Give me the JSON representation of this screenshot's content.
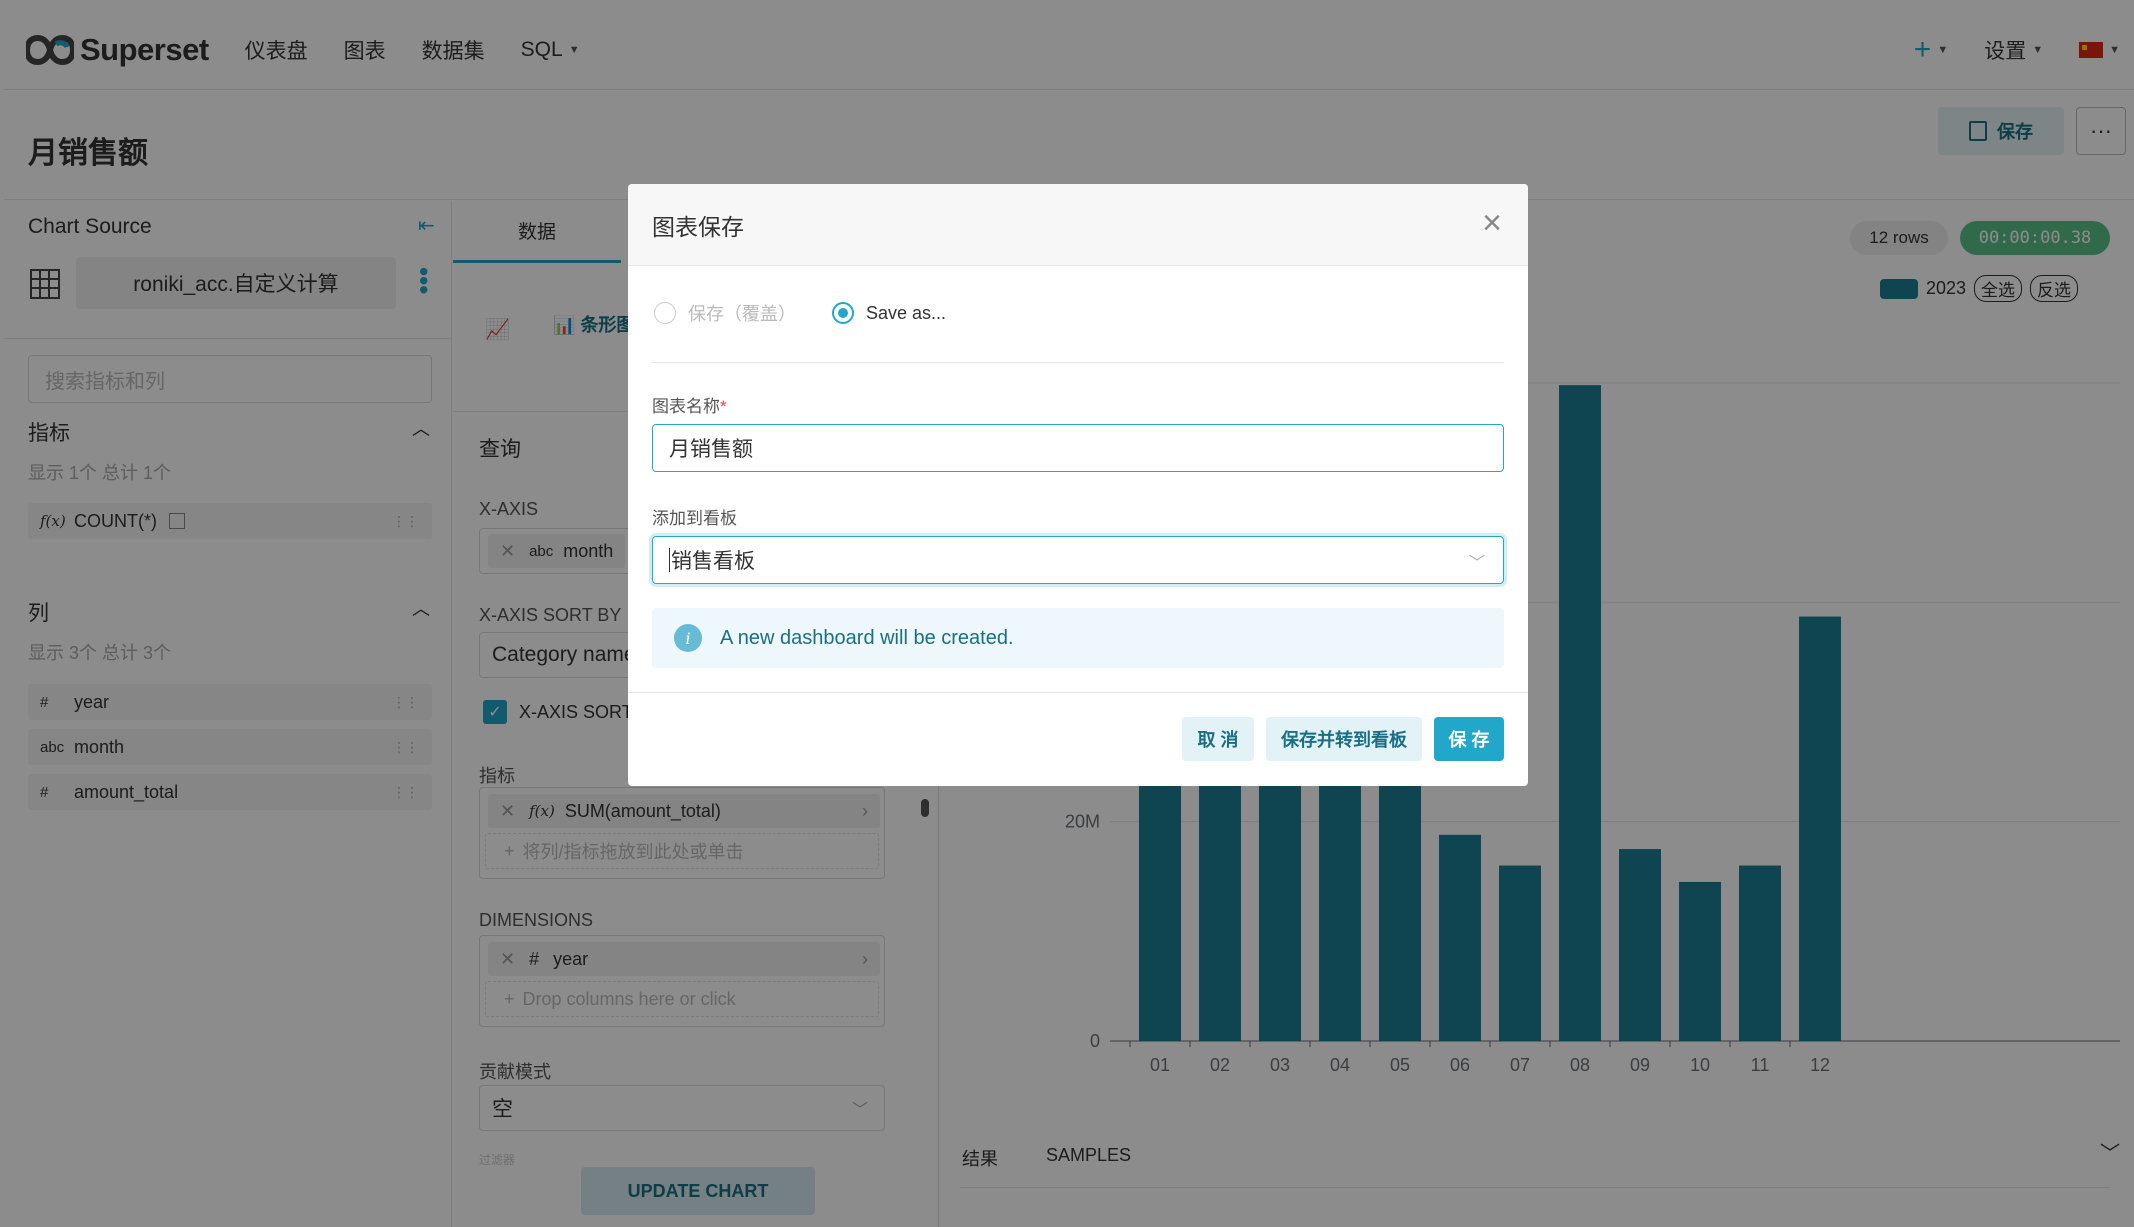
{
  "nav": {
    "logo_text": "Superset",
    "items": [
      "仪表盘",
      "图表",
      "数据集",
      "SQL"
    ],
    "settings_label": "设置"
  },
  "header": {
    "title": "月销售额",
    "save_label": "保存",
    "more_label": "···"
  },
  "left_panel": {
    "title": "Chart Source",
    "dataset_name": "roniki_acc.自定义计算",
    "search_placeholder": "搜索指标和列",
    "metrics": {
      "title": "指标",
      "summary": "显示 1个 总计 1个",
      "items": [
        {
          "type": "f(x)",
          "name": "COUNT(*)"
        }
      ]
    },
    "columns": {
      "title": "列",
      "summary": "显示 3个 总计 3个",
      "items": [
        {
          "type": "#",
          "name": "year"
        },
        {
          "type": "abc",
          "name": "month"
        },
        {
          "type": "#",
          "name": "amount_total"
        }
      ]
    }
  },
  "mid_panel": {
    "tab_data": "数据",
    "viz_type_label": "条形图",
    "query_title": "查询",
    "x_axis_label": "X-AXIS",
    "x_axis_value_type": "abc",
    "x_axis_value": "month",
    "x_axis_sort_label": "X-AXIS SORT BY",
    "x_axis_sort_value": "Category name",
    "x_axis_sort_asc_label": "X-AXIS SORT ASCENDING",
    "metrics_label": "指标",
    "metric_value": "SUM(amount_total)",
    "metric_drop_hint": "将列/指标拖放到此处或单击",
    "dimensions_label": "DIMENSIONS",
    "dimension_value": "year",
    "dimension_drop_hint": "Drop columns here or click",
    "contribution_label": "贡献模式",
    "contribution_value": "空",
    "filters_label": "过滤器",
    "update_label": "UPDATE CHART"
  },
  "right_panel": {
    "rows_badge": "12 rows",
    "time_badge": "00:00:00.38",
    "legend_label": "2023",
    "legend_select_all": "全选",
    "legend_invert": "反选",
    "results_tab": "结果",
    "samples_tab": "SAMPLES"
  },
  "chart_data": {
    "type": "bar",
    "categories": [
      "01",
      "02",
      "03",
      "04",
      "05",
      "06",
      "07",
      "08",
      "09",
      "10",
      "11",
      "12"
    ],
    "series": [
      {
        "name": "2023",
        "values": [
          23.5,
          27,
          26.5,
          25.5,
          26,
          18.8,
          16,
          59.8,
          17.5,
          14.5,
          16,
          38.7
        ]
      }
    ],
    "y_ticks": [
      "0",
      "20M"
    ],
    "ylim": [
      0,
      62
    ],
    "legend": "top-right",
    "color": "#1d7f93"
  },
  "modal": {
    "title": "图表保存",
    "radio_overwrite": "保存（覆盖）",
    "radio_save_as": "Save as...",
    "chart_name_label": "图表名称",
    "chart_name_value": "月销售额",
    "dashboard_label": "添加到看板",
    "dashboard_value": "销售看板",
    "info_text": "A new dashboard will be created.",
    "cancel_label": "取 消",
    "save_go_label": "保存并转到看板",
    "save_label": "保 存"
  }
}
